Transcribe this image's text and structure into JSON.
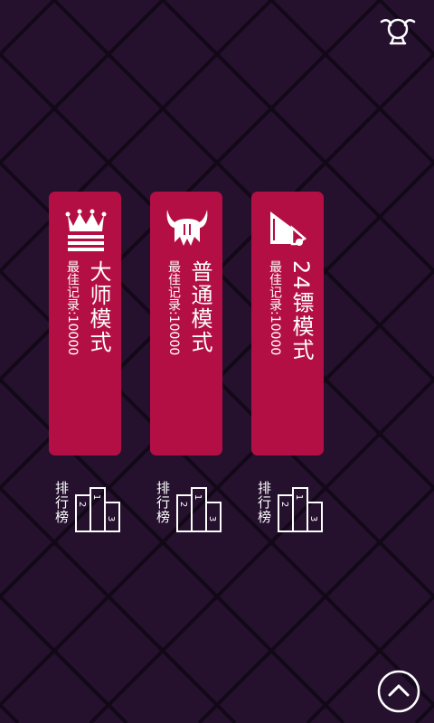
{
  "header": {
    "profile_icon": "user-icon"
  },
  "modes": [
    {
      "id": "master",
      "icon": "crown-icon",
      "title": "大师模式",
      "record_label": "最佳记录:",
      "record_value": "10000"
    },
    {
      "id": "normal",
      "icon": "viking-helmet-icon",
      "title": "普通模式",
      "record_label": "最佳记录:",
      "record_value": "10000"
    },
    {
      "id": "24darts",
      "icon": "triangle-flag-icon",
      "title": "24镖模式",
      "record_label": "最佳记录:",
      "record_value": "10000"
    }
  ],
  "leaderboards": [
    {
      "label": "排行榜",
      "icon": "podium-icon",
      "places": [
        "2",
        "1",
        "3"
      ]
    },
    {
      "label": "排行榜",
      "icon": "podium-icon",
      "places": [
        "2",
        "1",
        "3"
      ]
    },
    {
      "label": "排行榜",
      "icon": "podium-icon",
      "places": [
        "2",
        "1",
        "3"
      ]
    }
  ],
  "footer": {
    "up_icon": "chevron-up-icon"
  },
  "colors": {
    "background": "#25112e",
    "card": "#b30f45",
    "grid": "#120818",
    "text": "#ffffff"
  }
}
